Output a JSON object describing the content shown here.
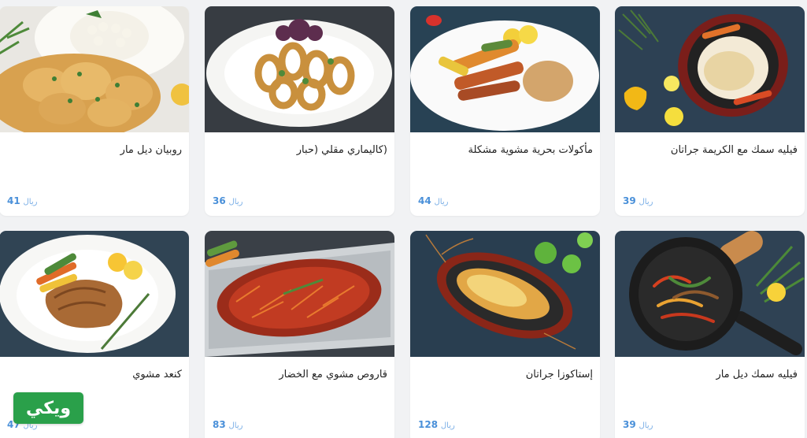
{
  "currency_label": "ريال",
  "brand": {
    "logo_text": "ويكي"
  },
  "items": [
    {
      "name": "روبيان ديل مار",
      "price": "41"
    },
    {
      "name": "(كاليماري مقلي (حبار",
      "price": "36"
    },
    {
      "name": "مأكولات بحرية مشوية مشكلة",
      "price": "44"
    },
    {
      "name": "فيليه سمك مع الكريمة جراتان",
      "price": "39"
    },
    {
      "name": "كنعد مشوي",
      "price": "47"
    },
    {
      "name": "قاروص مشوي مع الخضار",
      "price": "83"
    },
    {
      "name": "إستاكوزا جراتان",
      "price": "128"
    },
    {
      "name": "فيليه سمك ديل مار",
      "price": "39"
    }
  ],
  "colors": {
    "accent_price": "#4a90d9",
    "logo_green": "#2aa04a",
    "page_bg": "#f1f2f4"
  }
}
